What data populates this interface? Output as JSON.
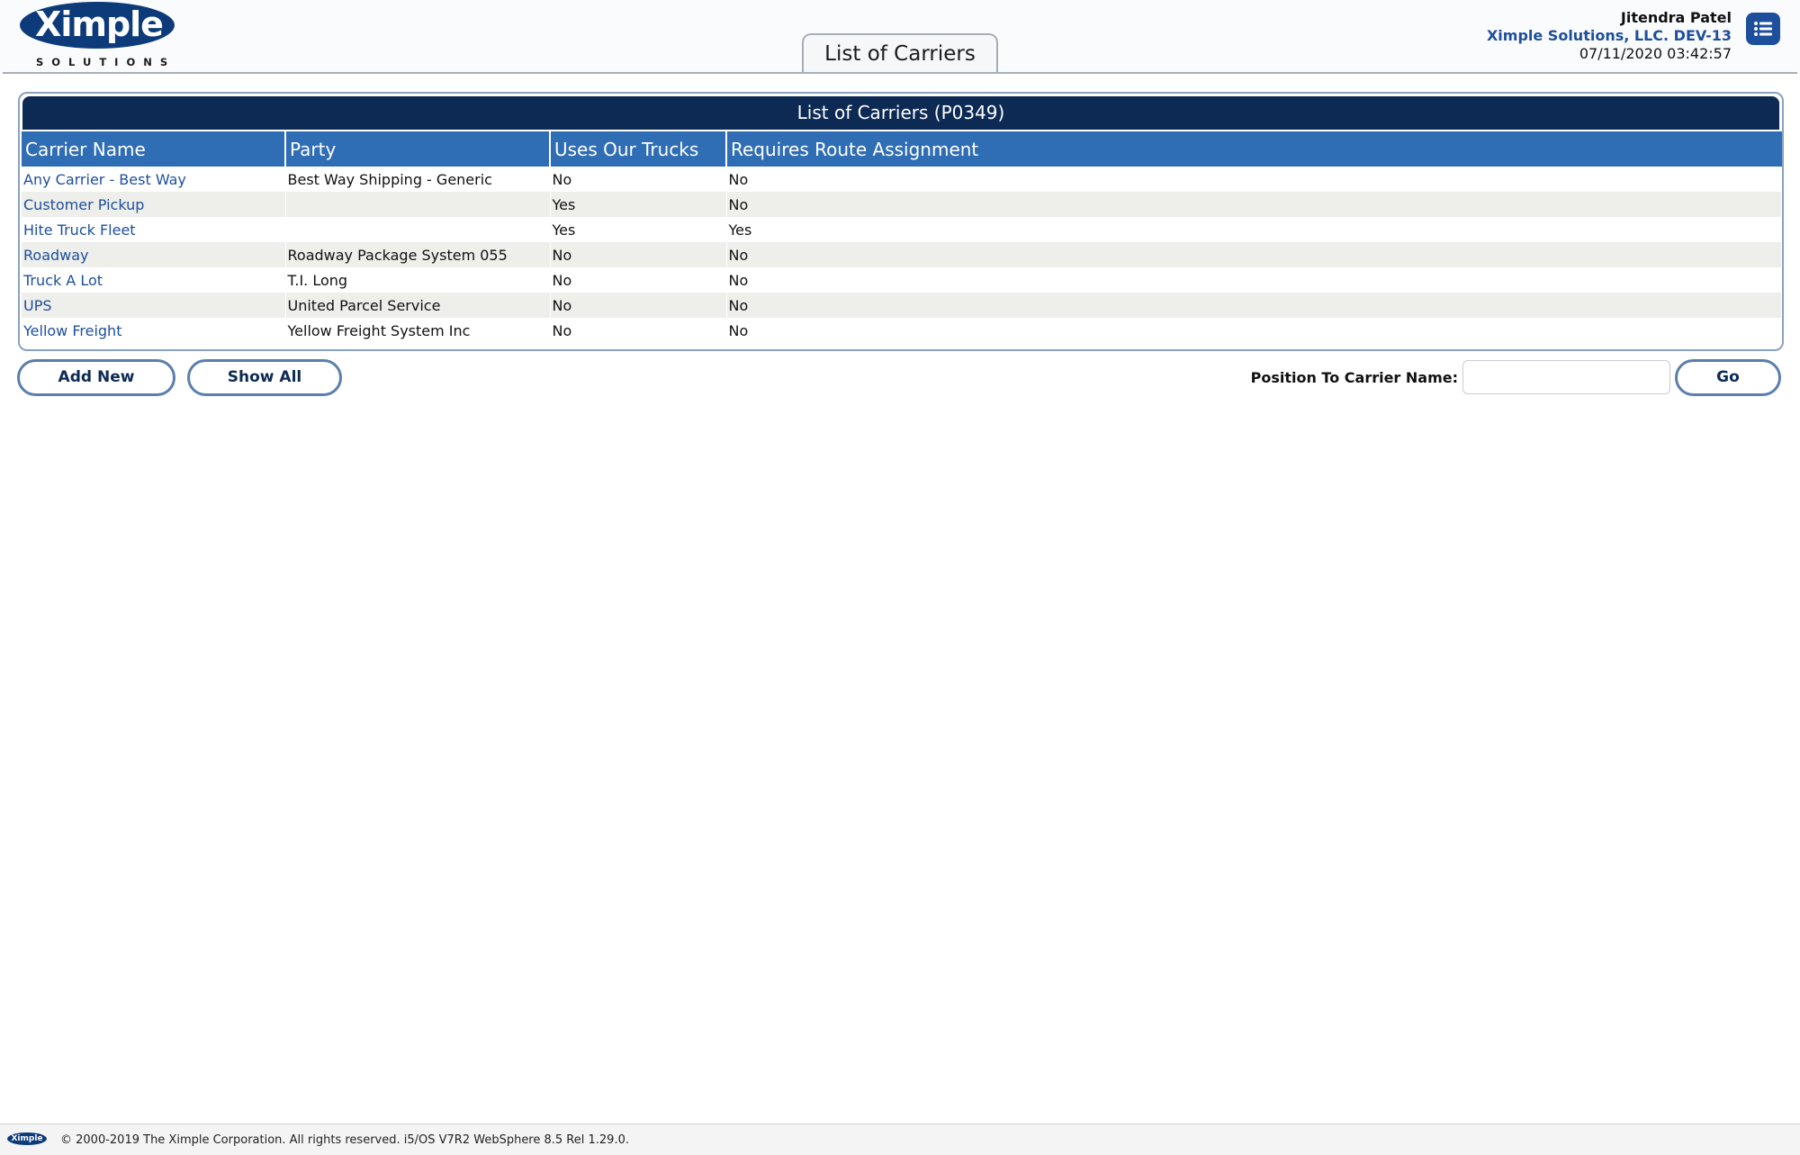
{
  "header": {
    "logo_text": "Ximple",
    "logo_subtext": "SOLUTIONS",
    "page_tab": "List of Carriers",
    "user_name": "Jitendra Patel",
    "company": "Ximple Solutions, LLC. DEV-13",
    "datetime": "07/11/2020 03:42:57",
    "menu_icon": "list-menu-icon"
  },
  "table": {
    "title": "List of Carriers (P0349)",
    "columns": [
      "Carrier Name",
      "Party",
      "Uses Our Trucks",
      "Requires Route Assignment"
    ],
    "rows": [
      [
        "Any Carrier - Best Way",
        "Best Way Shipping - Generic",
        "No",
        "No"
      ],
      [
        "Customer Pickup",
        "",
        "Yes",
        "No"
      ],
      [
        "Hite Truck Fleet",
        "",
        "Yes",
        "Yes"
      ],
      [
        "Roadway",
        "Roadway Package System 055",
        "No",
        "No"
      ],
      [
        "Truck A Lot",
        "T.I. Long",
        "No",
        "No"
      ],
      [
        "UPS",
        "United Parcel Service",
        "No",
        "No"
      ],
      [
        "Yellow Freight",
        "Yellow Freight System Inc",
        "No",
        "No"
      ]
    ]
  },
  "actions": {
    "add_new": "Add New",
    "show_all": "Show All",
    "position_label": "Position To Carrier Name:",
    "position_value": "",
    "go": "Go"
  },
  "footer": {
    "logo_text": "Ximple",
    "text": "© 2000-2019 The Ximple Corporation. All rights reserved. i5/OS V7R2 WebSphere 8.5 Rel 1.29.0."
  },
  "colors": {
    "brand": "#0d3b7a",
    "title_bar": "#0d2a55",
    "header_row": "#2f6db5",
    "link": "#1d4f9c",
    "row_alt": "#eeeeeb"
  }
}
